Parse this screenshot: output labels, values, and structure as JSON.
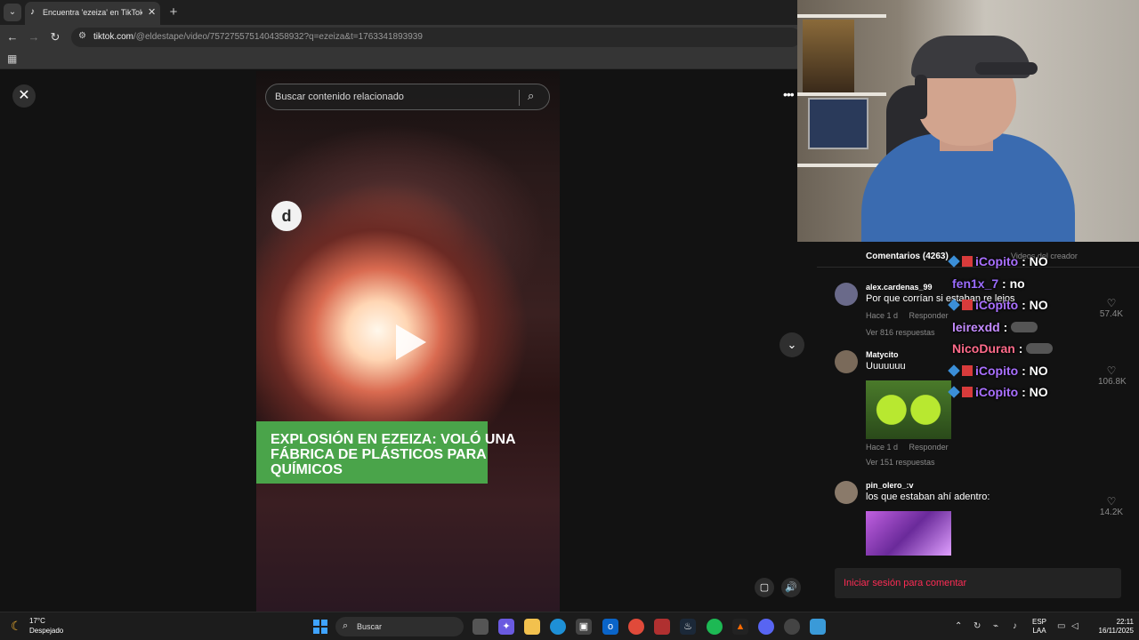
{
  "browser": {
    "tab_title": "Encuentra 'ezeiza' en TikTok | Bú",
    "url_domain": "tiktok.com",
    "url_path": "/@eldestape/video/7572755751404358932?q=ezeiza&t=1763341893939"
  },
  "search": {
    "placeholder": "Buscar contenido relacionado"
  },
  "video": {
    "logo_text": "d",
    "headline": "EXPLOSIÓN EN EZEIZA: VOLÓ UNA FÁBRICA DE PLÁSTICOS PARA QUÍMICOS"
  },
  "comments": {
    "title": "Comentarios (4263)",
    "creator_tab": "Videos del creador",
    "items": [
      {
        "user": "alex.cardenas_99",
        "text": "Por que corrían si estaban re lejos",
        "time": "Hace 1 d",
        "reply": "Responder",
        "replies": "Ver 816 respuestas",
        "likes": "57.4K"
      },
      {
        "user": "Matycito",
        "text": "Uuuuuuu",
        "time": "Hace 1 d",
        "reply": "Responder",
        "replies": "Ver 151 respuestas",
        "likes": "106.8K"
      },
      {
        "user": "pin_olero_:v",
        "text": "los que estaban ahí adentro:",
        "likes": "14.2K"
      }
    ],
    "login": "Iniciar sesión para comentar"
  },
  "chat": [
    {
      "user": "iCopito",
      "msg": ": NO",
      "color": "#a970ff",
      "badges": true
    },
    {
      "user": "fen1x_7",
      "msg": ": no",
      "color": "#9b6cff",
      "badges": false
    },
    {
      "user": "iCopito",
      "msg": ": NO",
      "color": "#a970ff",
      "badges": true
    },
    {
      "user": "leirexdd",
      "msg": ":",
      "color": "#c48bff",
      "badges": false,
      "emote": true
    },
    {
      "user": "NicoDuran",
      "msg": ":",
      "color": "#ff6b8a",
      "badges": false,
      "emote": true
    },
    {
      "user": "iCopito",
      "msg": ": NO",
      "color": "#a970ff",
      "badges": true
    },
    {
      "user": "iCopito",
      "msg": ": NO",
      "color": "#a970ff",
      "badges": true
    }
  ],
  "taskbar": {
    "temp": "17°C",
    "weather": "Despejado",
    "search": "Buscar",
    "lang1": "ESP",
    "lang2": "LAA",
    "time": "22:11",
    "date": "16/11/2025"
  }
}
